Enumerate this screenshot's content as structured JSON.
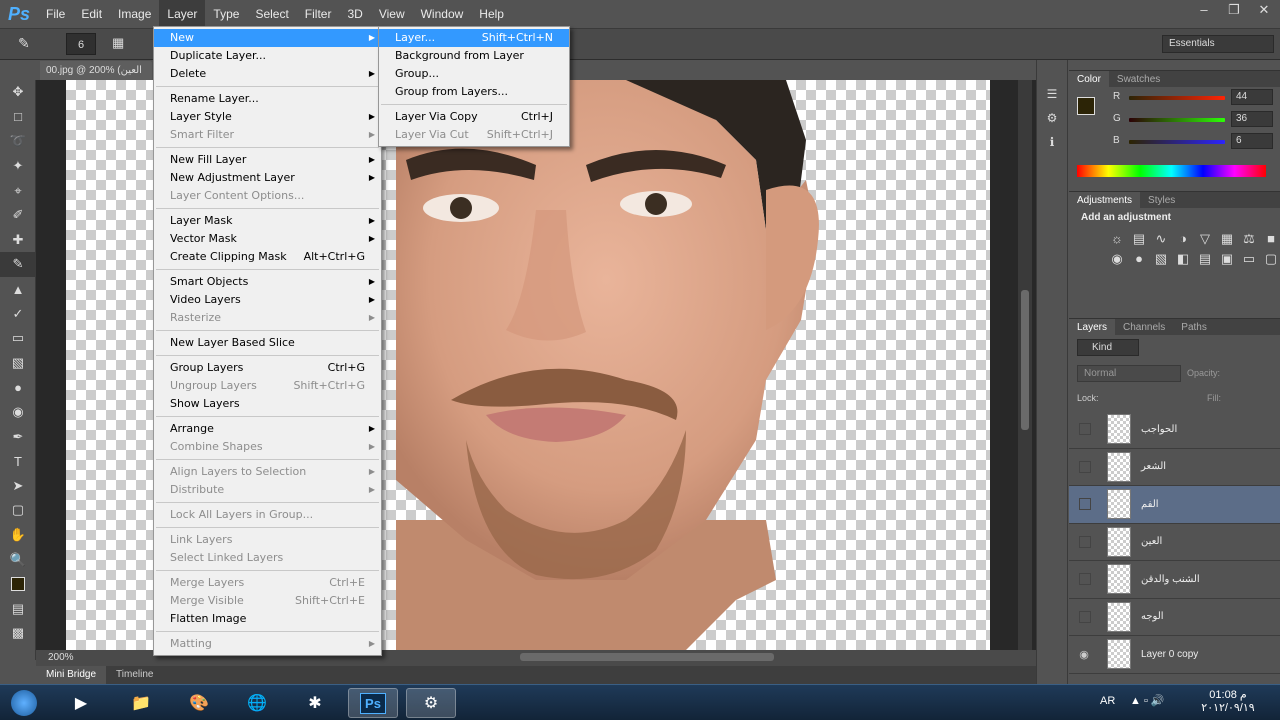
{
  "app": {
    "logo": "Ps"
  },
  "menubar": [
    "File",
    "Edit",
    "Image",
    "Layer",
    "Type",
    "Select",
    "Filter",
    "3D",
    "View",
    "Window",
    "Help"
  ],
  "optbar": {
    "brush_size": "6",
    "workspace": "Essentials"
  },
  "document": {
    "tab": "00.jpg @ 200% (العين",
    "zoom": "200%"
  },
  "bottom_tabs": [
    "Mini Bridge",
    "Timeline"
  ],
  "layer_menu": [
    {
      "label": "New",
      "arrow": true,
      "highlight": true
    },
    {
      "label": "Duplicate Layer..."
    },
    {
      "label": "Delete",
      "arrow": true
    },
    {
      "sep": true
    },
    {
      "label": "Rename Layer..."
    },
    {
      "label": "Layer Style",
      "arrow": true
    },
    {
      "label": "Smart Filter",
      "arrow": true,
      "disabled": true
    },
    {
      "sep": true
    },
    {
      "label": "New Fill Layer",
      "arrow": true
    },
    {
      "label": "New Adjustment Layer",
      "arrow": true
    },
    {
      "label": "Layer Content Options...",
      "disabled": true
    },
    {
      "sep": true
    },
    {
      "label": "Layer Mask",
      "arrow": true
    },
    {
      "label": "Vector Mask",
      "arrow": true
    },
    {
      "label": "Create Clipping Mask",
      "shortcut": "Alt+Ctrl+G"
    },
    {
      "sep": true
    },
    {
      "label": "Smart Objects",
      "arrow": true
    },
    {
      "label": "Video Layers",
      "arrow": true
    },
    {
      "label": "Rasterize",
      "arrow": true,
      "disabled": true
    },
    {
      "sep": true
    },
    {
      "label": "New Layer Based Slice"
    },
    {
      "sep": true
    },
    {
      "label": "Group Layers",
      "shortcut": "Ctrl+G"
    },
    {
      "label": "Ungroup Layers",
      "shortcut": "Shift+Ctrl+G",
      "disabled": true
    },
    {
      "label": "Show Layers"
    },
    {
      "sep": true
    },
    {
      "label": "Arrange",
      "arrow": true
    },
    {
      "label": "Combine Shapes",
      "arrow": true,
      "disabled": true
    },
    {
      "sep": true
    },
    {
      "label": "Align Layers to Selection",
      "arrow": true,
      "disabled": true
    },
    {
      "label": "Distribute",
      "arrow": true,
      "disabled": true
    },
    {
      "sep": true
    },
    {
      "label": "Lock All Layers in Group...",
      "disabled": true
    },
    {
      "sep": true
    },
    {
      "label": "Link Layers",
      "disabled": true
    },
    {
      "label": "Select Linked Layers",
      "disabled": true
    },
    {
      "sep": true
    },
    {
      "label": "Merge Layers",
      "shortcut": "Ctrl+E",
      "disabled": true
    },
    {
      "label": "Merge Visible",
      "shortcut": "Shift+Ctrl+E",
      "disabled": true
    },
    {
      "label": "Flatten Image"
    },
    {
      "sep": true
    },
    {
      "label": "Matting",
      "arrow": true,
      "disabled": true
    }
  ],
  "new_submenu": [
    {
      "label": "Layer...",
      "shortcut": "Shift+Ctrl+N",
      "highlight": true
    },
    {
      "label": "Background from Layer"
    },
    {
      "label": "Group..."
    },
    {
      "label": "Group from Layers..."
    },
    {
      "sep": true
    },
    {
      "label": "Layer Via Copy",
      "shortcut": "Ctrl+J"
    },
    {
      "label": "Layer Via Cut",
      "shortcut": "Shift+Ctrl+J",
      "disabled": true
    }
  ],
  "color_panel": {
    "tabs": [
      "Color",
      "Swatches"
    ],
    "r": {
      "label": "R",
      "value": "44"
    },
    "g": {
      "label": "G",
      "value": "36"
    },
    "b": {
      "label": "B",
      "value": "6"
    },
    "fg_color": "#2c2406"
  },
  "adjustments_panel": {
    "tabs": [
      "Adjustments",
      "Styles"
    ],
    "title": "Add an adjustment"
  },
  "layers_panel": {
    "tabs": [
      "Layers",
      "Channels",
      "Paths"
    ],
    "kind": "Kind",
    "blend": "Normal",
    "opacity_label": "Opacity:",
    "lock_label": "Lock:",
    "fill_label": "Fill:",
    "layers": [
      {
        "name": "الحواجب",
        "visible": false
      },
      {
        "name": "الشعر",
        "visible": false
      },
      {
        "name": "الفم",
        "visible": false,
        "selected": true
      },
      {
        "name": "العين",
        "visible": false
      },
      {
        "name": "الشنب والدقن",
        "visible": false
      },
      {
        "name": "الوجه",
        "visible": false
      },
      {
        "name": "Layer 0 copy",
        "visible": true
      }
    ]
  },
  "taskbar": {
    "lang": "AR",
    "time": "01:08 م",
    "date": "٢٠١٢/٠٩/١٩"
  }
}
